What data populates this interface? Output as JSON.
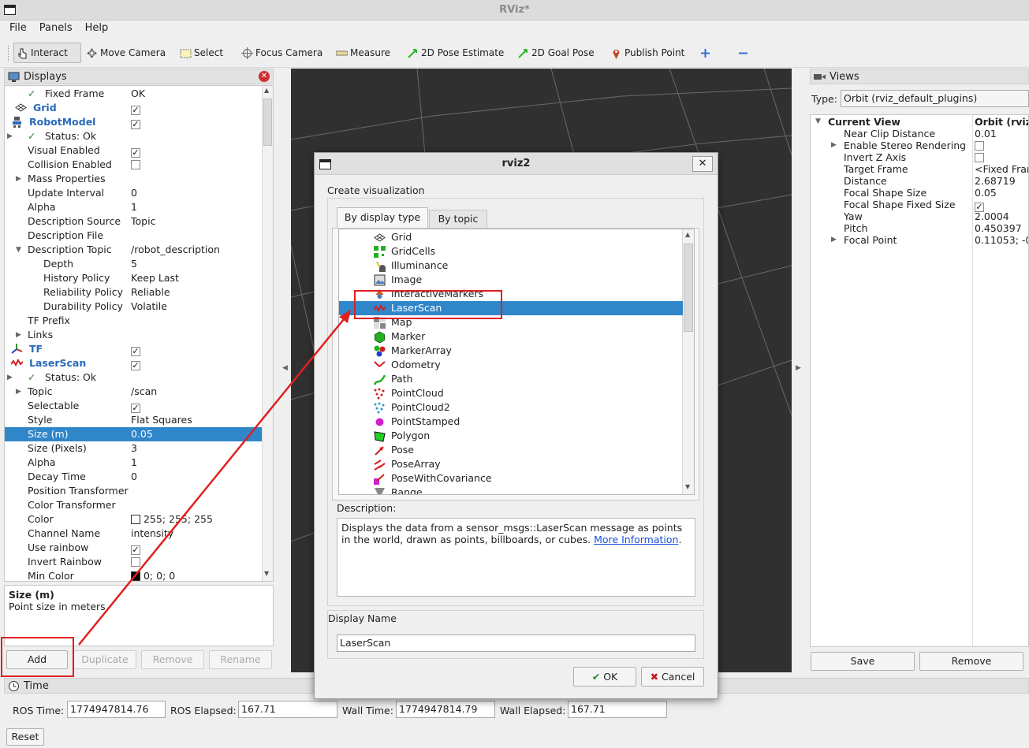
{
  "window": {
    "title": "RViz*"
  },
  "menu": [
    "File",
    "Panels",
    "Help"
  ],
  "toolbar": [
    {
      "label": "Interact",
      "icon": "hand-pointer-icon",
      "active": true
    },
    {
      "label": "Move Camera",
      "icon": "move-camera-icon"
    },
    {
      "label": "Select",
      "icon": "select-rect-icon"
    },
    {
      "label": "Focus Camera",
      "icon": "focus-camera-icon"
    },
    {
      "label": "Measure",
      "icon": "ruler-icon"
    },
    {
      "label": "2D Pose Estimate",
      "icon": "green-arrow-icon"
    },
    {
      "label": "2D Goal Pose",
      "icon": "green-arrow-icon"
    },
    {
      "label": "Publish Point",
      "icon": "map-pin-icon"
    }
  ],
  "displays": {
    "title": "Displays",
    "rows": [
      {
        "k": "Fixed Frame",
        "v": "OK"
      },
      {
        "k": "Grid",
        "v": ""
      },
      {
        "k": "RobotModel",
        "v": ""
      },
      {
        "k": "Status: Ok",
        "v": ""
      },
      {
        "k": "Visual Enabled",
        "v": ""
      },
      {
        "k": "Collision Enabled",
        "v": ""
      },
      {
        "k": "Mass Properties",
        "v": ""
      },
      {
        "k": "Update Interval",
        "v": "0"
      },
      {
        "k": "Alpha",
        "v": "1"
      },
      {
        "k": "Description Source",
        "v": "Topic"
      },
      {
        "k": "Description File",
        "v": ""
      },
      {
        "k": "Description Topic",
        "v": "/robot_description"
      },
      {
        "k": "Depth",
        "v": "5"
      },
      {
        "k": "History Policy",
        "v": "Keep Last"
      },
      {
        "k": "Reliability Policy",
        "v": "Reliable"
      },
      {
        "k": "Durability Policy",
        "v": "Volatile"
      },
      {
        "k": "TF Prefix",
        "v": ""
      },
      {
        "k": "Links",
        "v": ""
      },
      {
        "k": "TF",
        "v": ""
      },
      {
        "k": "LaserScan",
        "v": ""
      },
      {
        "k": "Status: Ok",
        "v": ""
      },
      {
        "k": "Topic",
        "v": "/scan"
      },
      {
        "k": "Selectable",
        "v": ""
      },
      {
        "k": "Style",
        "v": "Flat Squares"
      },
      {
        "k": "Size (m)",
        "v": "0.05"
      },
      {
        "k": "Size (Pixels)",
        "v": "3"
      },
      {
        "k": "Alpha",
        "v": "1"
      },
      {
        "k": "Decay Time",
        "v": "0"
      },
      {
        "k": "Position Transformer",
        "v": ""
      },
      {
        "k": "Color Transformer",
        "v": ""
      },
      {
        "k": "Color",
        "v": "255; 255; 255"
      },
      {
        "k": "Channel Name",
        "v": "intensity"
      },
      {
        "k": "Use rainbow",
        "v": ""
      },
      {
        "k": "Invert Rainbow",
        "v": ""
      },
      {
        "k": "Min Color",
        "v": "0; 0; 0"
      }
    ],
    "desc_title": "Size (m)",
    "desc_text": "Point size in meters.",
    "buttons": {
      "add": "Add",
      "duplicate": "Duplicate",
      "remove": "Remove",
      "rename": "Rename"
    }
  },
  "views": {
    "title": "Views",
    "type_label": "Type:",
    "type_value": "Orbit (rviz_default_plugins)",
    "header_k": "Current View",
    "header_v": "Orbit (rviz",
    "rows": [
      {
        "k": "Near Clip Distance",
        "v": "0.01"
      },
      {
        "k": "Enable Stereo Rendering",
        "v": ""
      },
      {
        "k": "Invert Z Axis",
        "v": ""
      },
      {
        "k": "Target Frame",
        "v": "<Fixed Fram"
      },
      {
        "k": "Distance",
        "v": "2.68719"
      },
      {
        "k": "Focal Shape Size",
        "v": "0.05"
      },
      {
        "k": "Focal Shape Fixed Size",
        "v": ""
      },
      {
        "k": "Yaw",
        "v": "2.0004"
      },
      {
        "k": "Pitch",
        "v": "0.450397"
      },
      {
        "k": "Focal Point",
        "v": "0.11053; -0"
      }
    ],
    "save": "Save",
    "remove": "Remove"
  },
  "time": {
    "title": "Time",
    "ros_time_label": "ROS Time:",
    "ros_time": "1774947814.76",
    "ros_elapsed_label": "ROS Elapsed:",
    "ros_elapsed": "167.71",
    "wall_time_label": "Wall Time:",
    "wall_time": "1774947814.79",
    "wall_elapsed_label": "Wall Elapsed:",
    "wall_elapsed": "167.71",
    "reset": "Reset"
  },
  "dialog": {
    "title": "rviz2",
    "heading": "Create visualization",
    "tab_display_type": "By display type",
    "tab_topic": "By topic",
    "items": [
      {
        "label": "Grid",
        "icon": "grid-icon"
      },
      {
        "label": "GridCells",
        "icon": "gridcells-icon"
      },
      {
        "label": "Illuminance",
        "icon": "illuminance-icon"
      },
      {
        "label": "Image",
        "icon": "image-icon"
      },
      {
        "label": "InteractiveMarkers",
        "icon": "interactive-markers-icon"
      },
      {
        "label": "LaserScan",
        "icon": "laserscan-icon"
      },
      {
        "label": "Map",
        "icon": "map-icon"
      },
      {
        "label": "Marker",
        "icon": "marker-icon"
      },
      {
        "label": "MarkerArray",
        "icon": "markerarray-icon"
      },
      {
        "label": "Odometry",
        "icon": "odometry-icon"
      },
      {
        "label": "Path",
        "icon": "path-icon"
      },
      {
        "label": "PointCloud",
        "icon": "pointcloud-icon"
      },
      {
        "label": "PointCloud2",
        "icon": "pointcloud2-icon"
      },
      {
        "label": "PointStamped",
        "icon": "pointstamped-icon"
      },
      {
        "label": "Polygon",
        "icon": "polygon-icon"
      },
      {
        "label": "Pose",
        "icon": "pose-icon"
      },
      {
        "label": "PoseArray",
        "icon": "posearray-icon"
      },
      {
        "label": "PoseWithCovariance",
        "icon": "posewithcovariance-icon"
      },
      {
        "label": "Range",
        "icon": "range-icon"
      }
    ],
    "description_label": "Description:",
    "description_text": "Displays the data from a sensor_msgs::LaserScan message as points in the world, drawn as points, billboards, or cubes.",
    "description_link": "More Information",
    "description_end": ".",
    "display_name_label": "Display Name",
    "display_name_value": "LaserScan",
    "ok": "OK",
    "cancel": "Cancel"
  }
}
